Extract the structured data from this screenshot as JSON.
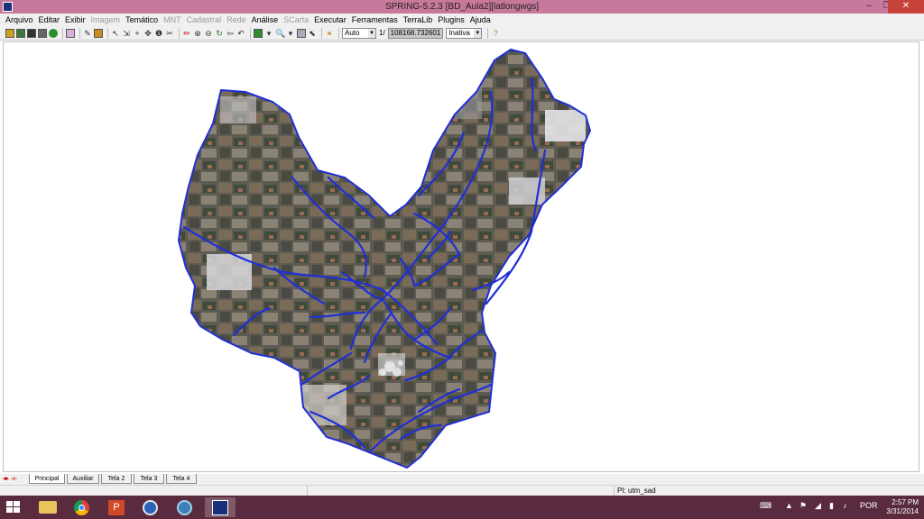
{
  "window": {
    "title": "SPRING-5.2.3 [BD_Aula2][latlongwgs]",
    "minimize": "–",
    "maximize": "❐",
    "close": "✕"
  },
  "menu": [
    {
      "label": "Arquivo",
      "enabled": true
    },
    {
      "label": "Editar",
      "enabled": true
    },
    {
      "label": "Exibir",
      "enabled": true
    },
    {
      "label": "Imagem",
      "enabled": false
    },
    {
      "label": "Temático",
      "enabled": true
    },
    {
      "label": "MNT",
      "enabled": false
    },
    {
      "label": "Cadastral",
      "enabled": false
    },
    {
      "label": "Rede",
      "enabled": false
    },
    {
      "label": "Análise",
      "enabled": true
    },
    {
      "label": "SCarta",
      "enabled": false
    },
    {
      "label": "Executar",
      "enabled": true
    },
    {
      "label": "Ferramentas",
      "enabled": true
    },
    {
      "label": "TerraLib",
      "enabled": true
    },
    {
      "label": "Plugins",
      "enabled": true
    },
    {
      "label": "Ajuda",
      "enabled": true
    }
  ],
  "toolbar": {
    "zoom_mode": "Auto",
    "scale_prefix": "1/",
    "scale_value": "108168.732601",
    "mode": "Inativa"
  },
  "tabs": [
    {
      "label": "Principal",
      "active": true
    },
    {
      "label": "Auxiliar",
      "active": false
    },
    {
      "label": "Tela 2",
      "active": false
    },
    {
      "label": "Tela 3",
      "active": false
    },
    {
      "label": "Tela 4",
      "active": false
    }
  ],
  "status": {
    "projection": "PI: utm_sad"
  },
  "taskbar": {
    "language": "POR",
    "time": "2:57 PM",
    "date": "3/31/2014"
  },
  "colors": {
    "titlebar": "#c8789a",
    "taskbar": "#5a2b3e",
    "rivers": "#1f2fd6",
    "boundary": "#1f2fd6"
  }
}
